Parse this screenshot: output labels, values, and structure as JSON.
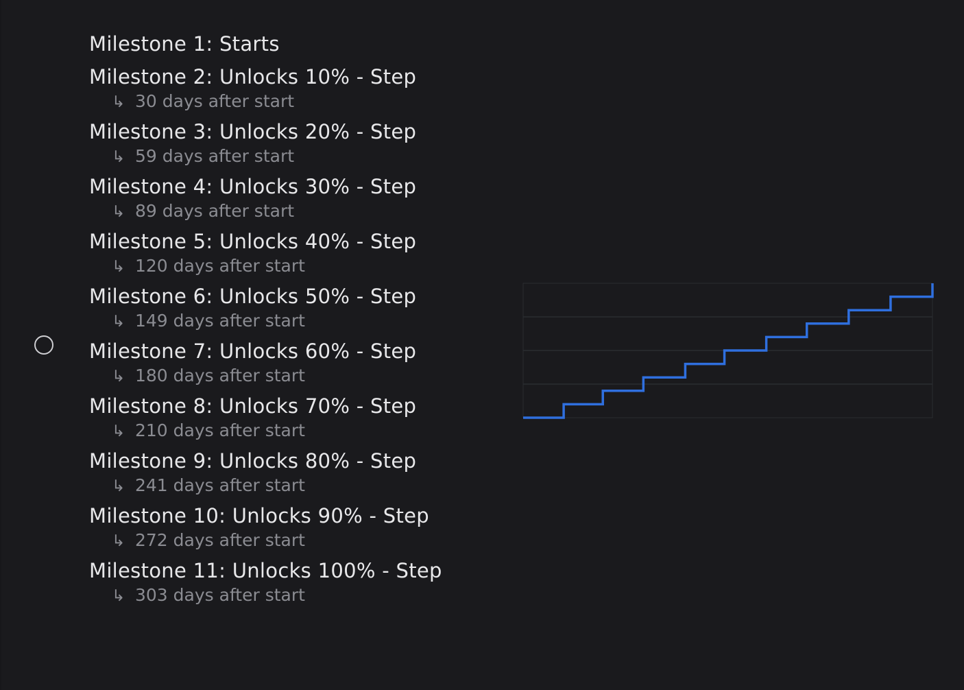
{
  "arrow_glyph": "↳",
  "colors": {
    "background": "#1a1a1d",
    "line": "#2f6fde",
    "grid": "#2b2c30",
    "title_text": "#e8e8ea",
    "sub_text": "#8b8c92"
  },
  "milestones": [
    {
      "title": "Milestone 1: Starts",
      "sub": ""
    },
    {
      "title": "Milestone 2: Unlocks 10% - Step",
      "sub": "30 days after start"
    },
    {
      "title": "Milestone 3: Unlocks 20% - Step",
      "sub": "59 days after start"
    },
    {
      "title": "Milestone 4: Unlocks 30% - Step",
      "sub": "89 days after start"
    },
    {
      "title": "Milestone 5: Unlocks 40% - Step",
      "sub": "120 days after start"
    },
    {
      "title": "Milestone 6: Unlocks 50% - Step",
      "sub": "149 days after start"
    },
    {
      "title": "Milestone 7: Unlocks 60% - Step",
      "sub": "180 days after start"
    },
    {
      "title": "Milestone 8: Unlocks 70% - Step",
      "sub": "210 days after start"
    },
    {
      "title": "Milestone 9: Unlocks 80% - Step",
      "sub": "241 days after start"
    },
    {
      "title": "Milestone 10: Unlocks 90% - Step",
      "sub": "272 days after start"
    },
    {
      "title": "Milestone 11: Unlocks 100% - Step",
      "sub": "303 days after start"
    }
  ],
  "chart_data": {
    "type": "line",
    "step": true,
    "x": [
      0,
      30,
      59,
      89,
      120,
      149,
      180,
      210,
      241,
      272,
      303
    ],
    "y": [
      0,
      10,
      20,
      30,
      40,
      50,
      60,
      70,
      80,
      90,
      100
    ],
    "xlim": [
      0,
      303
    ],
    "ylim": [
      0,
      100
    ],
    "grid": true,
    "title": "",
    "xlabel": "",
    "ylabel": ""
  }
}
